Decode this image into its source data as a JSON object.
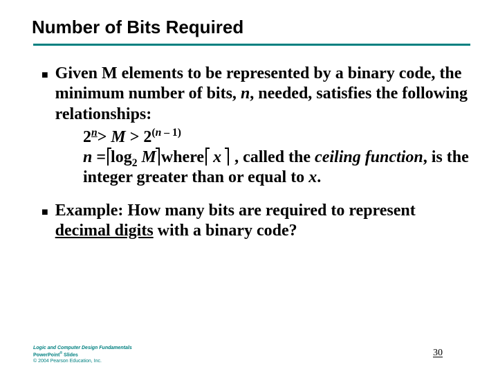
{
  "slide": {
    "title": "Number of Bits Required",
    "bullets": [
      {
        "lead": "Given M elements to be represented by a binary code, the minimum number of bits, ",
        "var_n": "n",
        "tail": ", needed, satisfies the following relationships:"
      },
      {
        "lead": "Example: How many bits are required to represent ",
        "underlined": "decimal digits",
        "tail": " with a binary code?"
      }
    ],
    "math": {
      "line1": {
        "two": "2",
        "exp_n": "n",
        "gt1": "> ",
        "M": "M",
        "ge": "  > ",
        "two_b": "2",
        "exp_open": "(",
        "exp_var": "n",
        "exp_minus": " – 1)",
        "full_sup_b": "(n – 1)"
      },
      "line2": {
        "n": "n",
        "eq": " =",
        "log": "log",
        "base": "2",
        "M": " M",
        "where": "where",
        "x": " x ",
        "comma": " , called the ",
        "ceilfn": "ceiling function",
        "rest": ", is the integer greater than or equal to ",
        "xvar": "x",
        "dot": "."
      }
    },
    "footer": {
      "line1": "Logic and Computer Design Fundamentals",
      "line2a": "PowerPoint",
      "line2sup": "®",
      "line2b": " Slides",
      "line3": "© 2004 Pearson Education, Inc."
    },
    "page": "30"
  }
}
